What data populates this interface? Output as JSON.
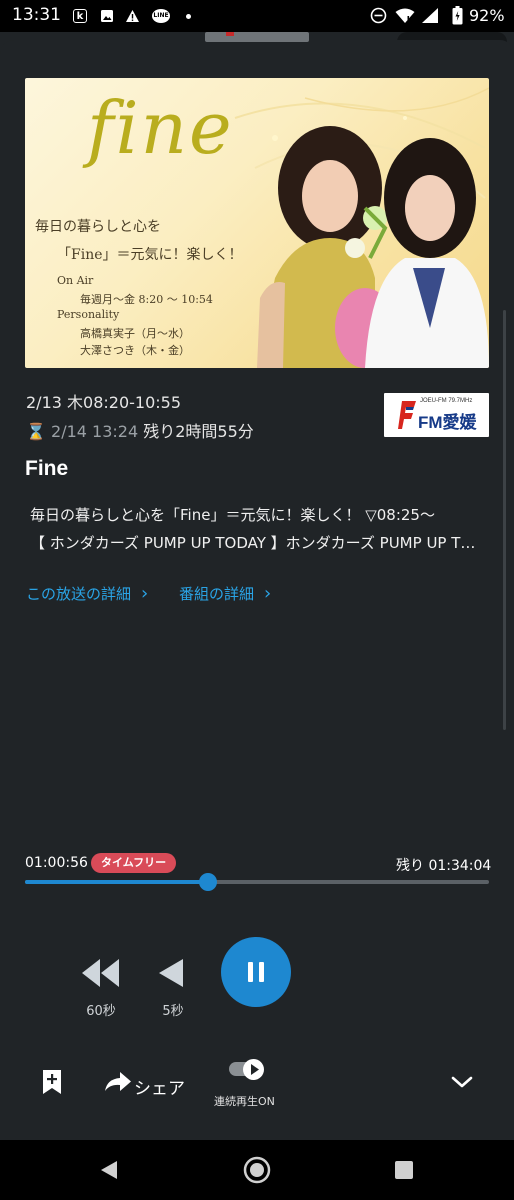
{
  "status_bar": {
    "time": "13:31",
    "battery_percent": "92%",
    "notification_icons": [
      "app-icon",
      "image-icon",
      "warning-icon",
      "line-icon",
      "dot"
    ],
    "system_icons": [
      "dnd-icon",
      "wifi-icon",
      "signal-icon",
      "battery-icon"
    ]
  },
  "banner": {
    "logo": "fine",
    "tagline_1": "毎日の暮らしと心を",
    "tagline_2": "「Fine」＝元気に！楽しく！",
    "onair_label": "On Air",
    "onair_time": "毎週月～金 8:20 ～ 10:54",
    "personality_label": "Personality",
    "host_1": "高橋真実子（月～水）",
    "host_2": "大澤さつき（木・金）"
  },
  "program": {
    "air_date": "2/13 木08:20-10:55",
    "deadline": "2/14 13:24",
    "remaining": "残り2時間55分",
    "station_name": "FM愛媛",
    "station_sub": "JOEU-FM 79.7MHz",
    "title": "Fine",
    "description_line1": "毎日の暮らしと心を「Fine」＝元気に！楽しく！ ▽08:25～",
    "description_line2": "【 ホンダカーズ PUMP UP TODAY 】ホンダカーズ PUMP UP T…"
  },
  "links": {
    "broadcast_detail": "この放送の詳細",
    "program_detail": "番組の詳細"
  },
  "player": {
    "elapsed": "01:00:56",
    "badge": "タイムフリー",
    "remaining": "残り 01:34:04",
    "progress_fraction": 0.395,
    "rewind_60_label": "60秒",
    "rewind_5_label": "5秒",
    "state": "playing"
  },
  "actions": {
    "share_label": "シェア",
    "continuous_label": "連続再生ON",
    "continuous_on": true
  },
  "colors": {
    "background": "#202427",
    "accent": "#1e88d0",
    "link": "#2aa4e6",
    "badge": "#d94b58"
  }
}
